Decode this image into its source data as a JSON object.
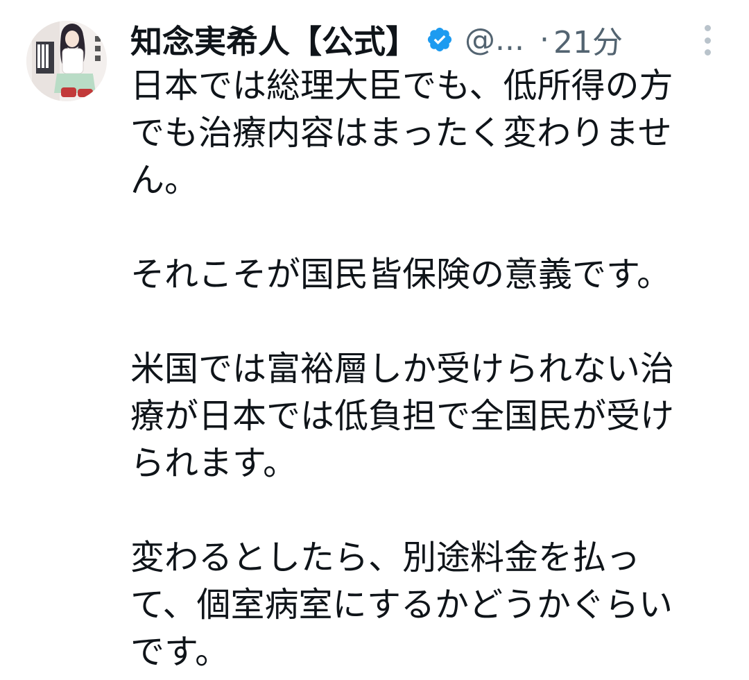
{
  "tweet": {
    "display_name": "知念実希人【公式】",
    "handle": "@...",
    "separator": "·",
    "time": "21分",
    "avatar_icon": "book-cover-avatar",
    "verified_icon": "verified-badge-icon",
    "more_icon": "more-options-icon",
    "colors": {
      "text": "#0f1419",
      "secondary": "#536471",
      "verified": "#1d9bf0"
    },
    "lines": [
      "日本では総理大臣でも、低所得の方",
      "でも治療内容はまったく変わりませ",
      "ん。",
      "",
      "それこそが国民皆保険の意義です。",
      "",
      "米国では富裕層しか受けられない治",
      "療が日本では低負担で全国民が受け",
      "られます。",
      "",
      "変わるとしたら、別途料金を払っ",
      "て、個室病室にするかどうかぐらい",
      "です。"
    ]
  }
}
